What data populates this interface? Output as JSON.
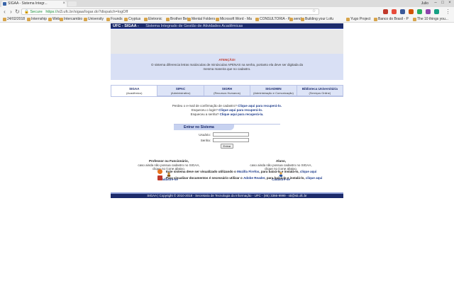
{
  "browser": {
    "tab_title": "SIGAA - Sistema Integr...",
    "profile": "Julio",
    "secure_label": "Secure",
    "url_scheme": "https://",
    "url_rest": "si3.ufc.br/sigaa/logar.do?dispatch=logOff",
    "bookmarks": [
      "24/02/2018",
      "Internship",
      "Web",
      "Intercambio",
      "University",
      "Founds",
      "Cryptus",
      "Eletronic",
      "Brother Bei",
      "Mental Folders",
      "Microsoft Word - Ma",
      "CONSULTORIA - R...",
      "send",
      "Building your Lofu",
      "Yugo Project",
      "Banco do Brasil - P",
      "The 10 things you..."
    ]
  },
  "header": {
    "brand": "UFC - SIGAA -",
    "subtitle": "Sistema Integrado de Gestão de Atividades Acadêmicas"
  },
  "alert": {
    "title": "ATENÇÃO!",
    "text": "O sistema diferencia letras maiúsculas de minúsculas APENAS na senha, portanto ela deve ser digitada da mesma maneira que no cadastro."
  },
  "systems": [
    {
      "name": "SIGAA",
      "desc": "(Acadêmico)"
    },
    {
      "name": "SIPAC",
      "desc": "(Administrativo)"
    },
    {
      "name": "SIGRH",
      "desc": "(Recursos Humanos)"
    },
    {
      "name": "SIGADMIN",
      "desc": "(Administração e Comunicação)"
    },
    {
      "name": "Biblioteca Universitária",
      "desc": "(Serviços Online)"
    }
  ],
  "recover": {
    "email_text": "Perdeu o e-mail de confirmação de cadastro?",
    "email_link": "Clique aqui para recuperá-lo.",
    "login_text": "Esqueceu o login?",
    "login_link": "Clique aqui para recuperá-lo.",
    "pass_text": "Esqueceu a senha?",
    "pass_link": "Clique aqui para recuperá-la."
  },
  "login": {
    "title": "Entrar no Sistema",
    "user_label": "Usuário:",
    "pass_label": "Senha:",
    "submit": "Entrar"
  },
  "staff": {
    "title": "Professor ou Funcionário,",
    "line1": "caso ainda não possua cadastro no SIGAA,",
    "line2": "clique no ícone abaixo.",
    "link": "Cadastre-se"
  },
  "student": {
    "title": "Aluno,",
    "line1": "caso ainda não possua cadastro no SIGAA,",
    "line2": "clique no ícone abaixo.",
    "link": "Cadastre-se"
  },
  "notes": {
    "firefox_pre": "Este sistema deve ser visualizado utilizando o",
    "firefox_name": "Mozilla Firefox",
    "firefox_mid": ", para baixá-lo e instalá-lo,",
    "firefox_link": "clique aqui",
    "reader_pre": "Para visualizar documentos é necessário utilizar o",
    "reader_name": "Adobe Reader",
    "reader_mid": ", para baixá-lo e instalá-lo,",
    "reader_link": "clique aqui"
  },
  "footer": {
    "text": "SIGAA | Copyright © 2010-2018 - Secretaria de Tecnologia da Informação - UFC - (85) 3366-9999 - sti@sti.ufc.br"
  },
  "colors": {
    "header": "#1c2b6b",
    "alert_bg": "#d9e0f5",
    "tab_bg": "#dde4f7",
    "link": "#1c3a8a",
    "alert_title": "#c0392b"
  }
}
